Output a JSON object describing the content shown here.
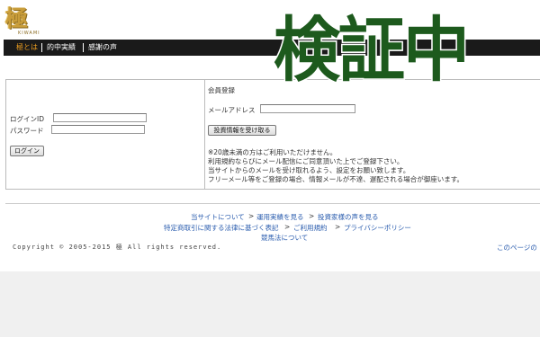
{
  "logo": {
    "text": "極",
    "sub": "KIWAMI"
  },
  "nav": {
    "items": [
      "極とは",
      "的中実績",
      "感謝の声"
    ],
    "active_color": "#f0a020"
  },
  "login": {
    "id_label": "ログインID",
    "password_label": "パスワード",
    "button": "ログイン"
  },
  "register": {
    "title": "会員登録",
    "email_label": "メールアドレス",
    "button": "投資情報を受け取る",
    "notes": [
      "※20歳未満の方はご利用いただけません。",
      "利用規約ならびにメール配信にご同意頂いた上でご登録下さい。",
      "当サイトからのメールを受け取れるよう、設定をお願い致します。",
      "フリーメール等をご登録の場合、情報メールが不達、遅配される場合が御座います。"
    ]
  },
  "footer": {
    "row1": [
      "当サイトについて",
      "運用実績を見る",
      "投資家様の声を見る"
    ],
    "row2": [
      "特定商取引に関する法律に基づく表記",
      "ご利用規約",
      "プライバシーポリシー"
    ],
    "row3": "競馬法について",
    "separator": ">",
    "copyright": "Copyright © 2005-2015 極 All rights reserved.",
    "page_top": "このページの"
  },
  "overlay": {
    "text": "検証中",
    "color": "#1d5a1d"
  }
}
